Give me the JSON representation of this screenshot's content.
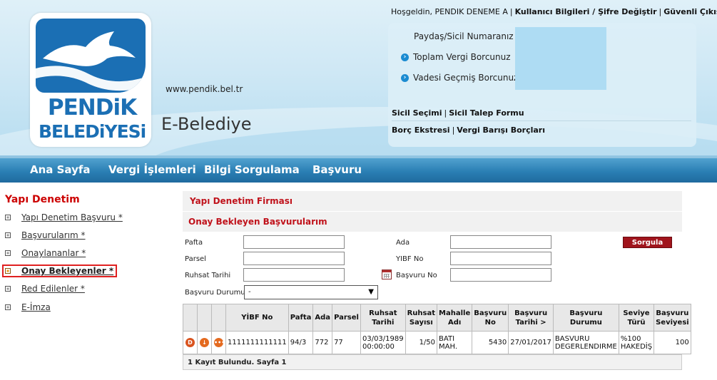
{
  "header": {
    "logo_line1": "PENDiK",
    "logo_line2": "BELEDiYESi",
    "site_url": "www.pendik.bel.tr",
    "site_title": "E-Belediye",
    "welcome": "Hoşgeldin, PENDIK DENEME A",
    "user_info_link": "Kullanıcı Bilgileri / Şifre Değiştir",
    "logout_link": "Güvenli Çıkış"
  },
  "info_panel": {
    "paydas_label": "Paydaş/Sicil Numaranız",
    "toplam_label": "Toplam Vergi Borcunuz",
    "vadesi_label": "Vadesi Geçmiş Borcunuz",
    "sicil_secimi": "Sicil Seçimi",
    "sicil_talep": "Sicil Talep Formu",
    "borc_ekstresi": "Borç Ekstresi",
    "vergi_barisi": "Vergi Barışı Borçları"
  },
  "nav": {
    "items": [
      "Ana Sayfa",
      "Vergi İşlemleri",
      "Bilgi Sorgulama",
      "Başvuru"
    ]
  },
  "sidebar": {
    "title": "Yapı Denetim",
    "items": [
      {
        "label": "Yapı Denetim Başvuru *"
      },
      {
        "label": "Başvurularım *"
      },
      {
        "label": "Onaylananlar *"
      },
      {
        "label": "Onay Bekleyenler *",
        "active": true
      },
      {
        "label": "Red Edilenler *"
      },
      {
        "label": "E-İmza"
      }
    ]
  },
  "main": {
    "section_title": "Yapı Denetim Firması",
    "subsection_title": "Onay Bekleyen Başvurularım",
    "form": {
      "pafta_label": "Pafta",
      "ada_label": "Ada",
      "parsel_label": "Parsel",
      "yibf_label": "YIBF No",
      "ruhsat_tarihi_label": "Ruhsat Tarihi",
      "basvuru_no_label": "Başvuru No",
      "basvuru_durumu_label": "Başvuru Durumu",
      "basvuru_durumu_value": "-",
      "search_button": "Sorgula"
    },
    "table": {
      "headers": [
        "",
        "",
        "",
        "YİBF No",
        "Pafta",
        "Ada",
        "Parsel",
        "Ruhsat Tarihi",
        "Ruhsat Sayısı",
        "Mahalle Adı",
        "Başvuru No",
        "Başvuru Tarihi >",
        "Başvuru Durumu",
        "Seviye Türü",
        "Başvuru Seviyesi"
      ],
      "rows": [
        {
          "yibf_no": "1111111111111",
          "pafta": "94/3",
          "ada": "772",
          "parsel": "77",
          "ruhsat_tarihi": "03/03/1989 00:00:00",
          "ruhsat_sayisi": "1/50",
          "mahalle": "BATI MAH.",
          "basvuru_no": "5430",
          "basvuru_tarihi": "27/01/2017",
          "basvuru_durumu": "BASVURU DEGERLENDIRME",
          "seviye_turu": "%100 HAKEDİŞ",
          "basvuru_seviyesi": "100"
        }
      ],
      "footer": "1 Kayıt Bulundu. Sayfa 1"
    }
  },
  "colors": {
    "brand_blue": "#1b6fb4",
    "nav_blue": "#2a7fb4",
    "accent_red": "#c0121b",
    "button_red": "#a0141c"
  }
}
